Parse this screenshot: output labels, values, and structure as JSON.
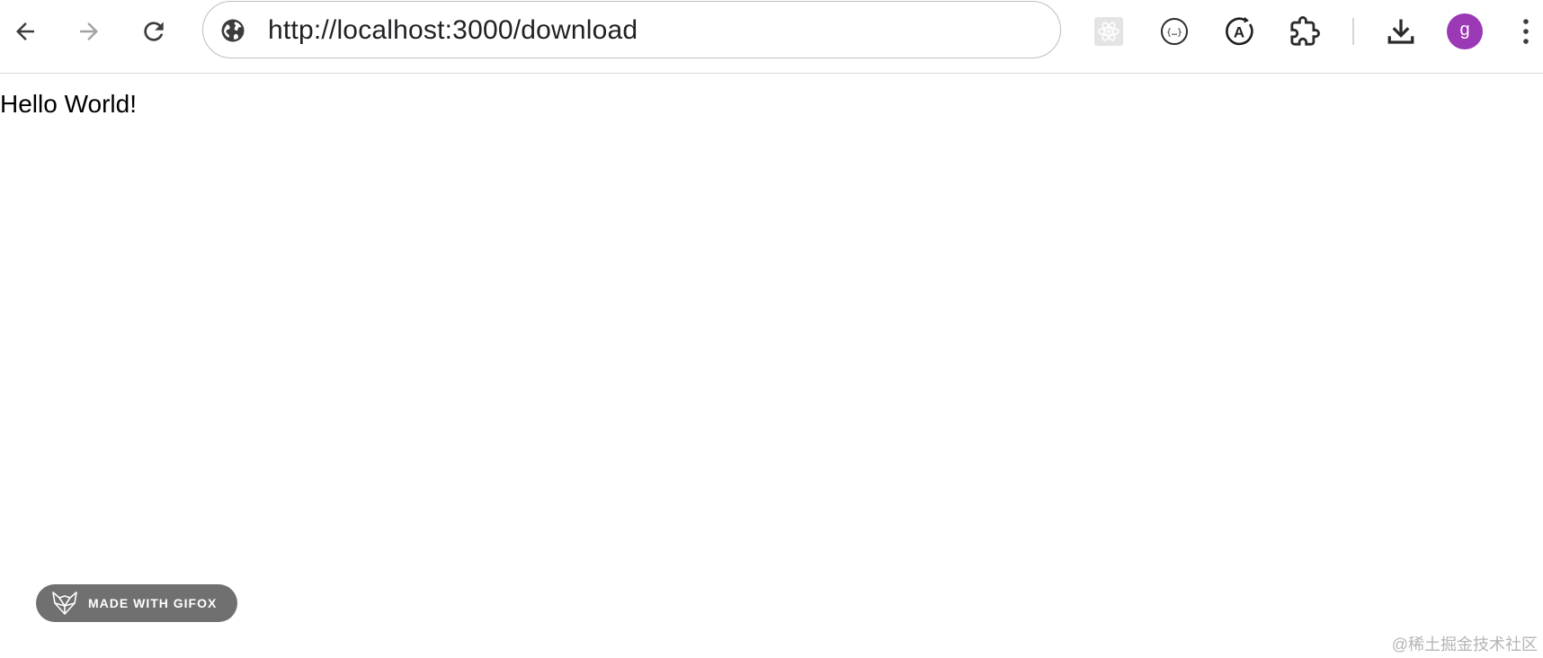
{
  "browser": {
    "url": "http://localhost:3000/download",
    "nav": {
      "back_icon": "arrow-left-icon",
      "forward_icon": "arrow-right-icon",
      "reload_icon": "reload-icon"
    },
    "extensions": [
      {
        "name": "react-devtools-icon"
      },
      {
        "name": "json-formatter-icon"
      },
      {
        "name": "translate-icon"
      },
      {
        "name": "extensions-puzzle-icon"
      }
    ],
    "profile": {
      "initial": "g",
      "color": "#9b38b5"
    }
  },
  "page": {
    "text": "Hello World!"
  },
  "badge": {
    "label": "MADE WITH GIFOX"
  },
  "watermark": {
    "text": "@稀土掘金技术社区"
  }
}
